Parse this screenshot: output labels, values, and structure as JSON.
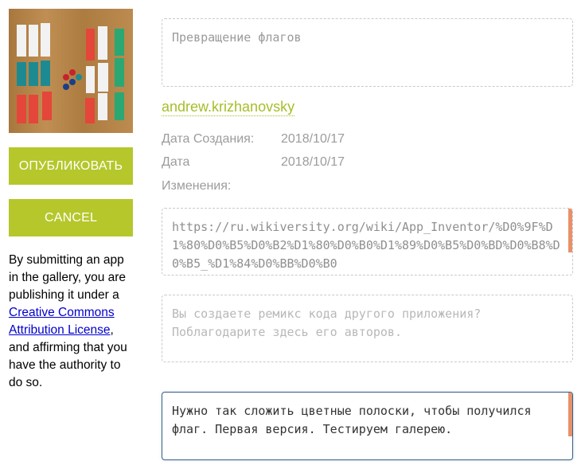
{
  "app": {
    "title_placeholder": "Превращение флагов",
    "author": "andrew.krizhanovsky",
    "created_label": "Дата Создания:",
    "created_value": "2018/10/17",
    "modified_label_line1": "Дата",
    "modified_label_line2": "Изменения:",
    "modified_value": "2018/10/17",
    "url_value": "https://ru.wikiversity.org/wiki/App_Inventor/%D0%9F%D1%80%D0%B5%D0%B2%D1%80%D0%B0%D1%89%D0%B5%D0%BD%D0%B8%D0%B5_%D1%84%D0%BB%D0%B0",
    "remix_placeholder": "Вы создаете ремикс кода другого приложения? Поблагодарите здесь его авторов.",
    "description_value": "Нужно так сложить цветные полоски, чтобы получился флаг. Первая версия. Тестируем галерею."
  },
  "actions": {
    "publish_label": "ОПУБЛИКОВАТЬ",
    "cancel_label": "CANCEL"
  },
  "notice": {
    "text_before": "By submitting an app in the gallery, you are publishing it under a ",
    "link_text": "Creative Commons Attribution License",
    "text_after": ", and affirming that you have the authority to do so."
  },
  "colors": {
    "accent": "#b5c72b",
    "author_link": "#a8bd2a",
    "scroll_marker": "#e8906a",
    "link": "#0000cc"
  },
  "icons": {
    "thumbnail": "app-screenshot-image"
  }
}
